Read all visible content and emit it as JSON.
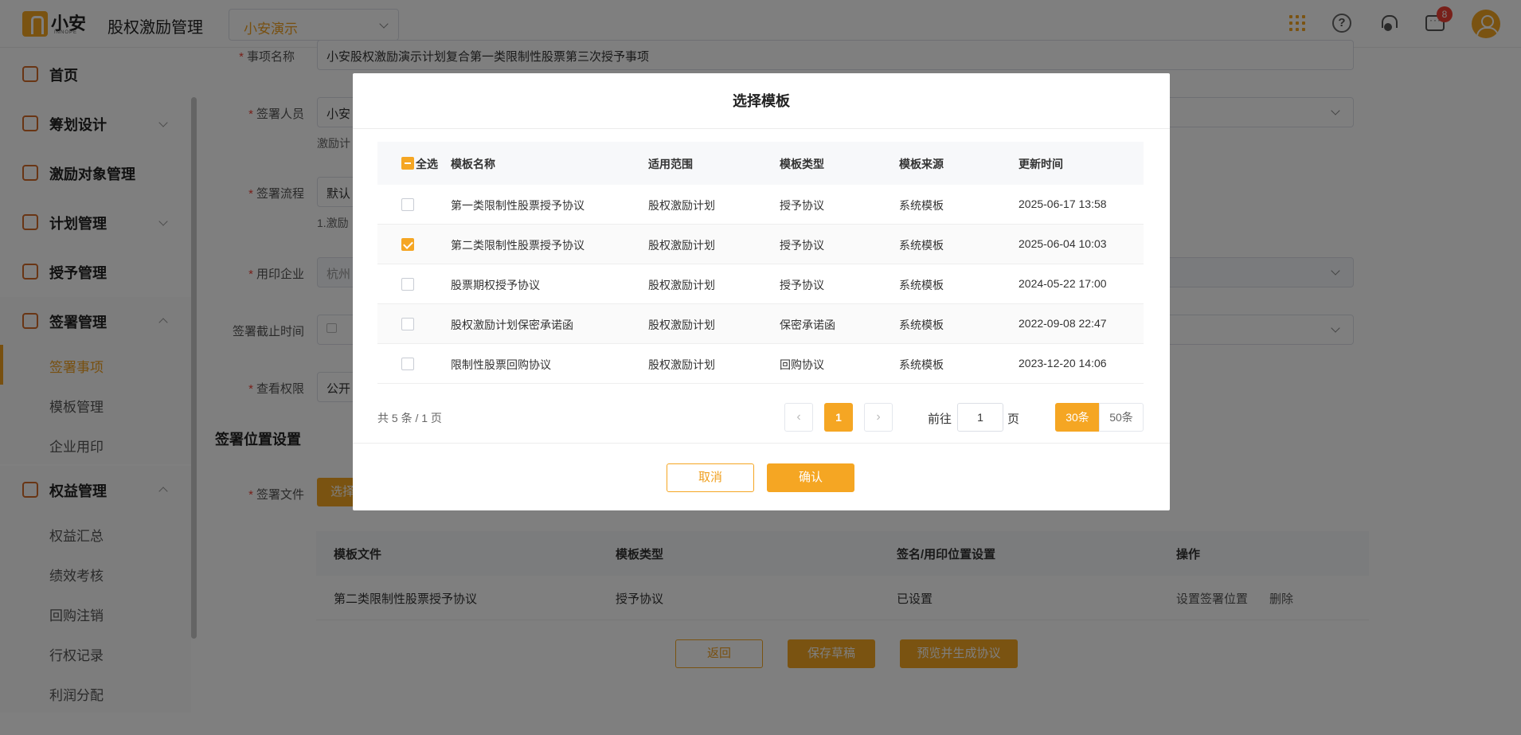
{
  "header": {
    "logo_cn": "小安",
    "logo_en": "INNOPE",
    "app_title": "股权激励管理",
    "project": "小安演示",
    "help": "?",
    "badge_count": "8"
  },
  "sidebar": {
    "items": [
      {
        "label": "首页",
        "icon": "home-icon"
      },
      {
        "label": "筹划设计",
        "icon": "edit-icon"
      },
      {
        "label": "激励对象管理",
        "icon": "users-icon"
      },
      {
        "label": "计划管理",
        "icon": "apps-icon"
      },
      {
        "label": "授予管理",
        "icon": "document-icon"
      },
      {
        "label": "签署管理",
        "icon": "sign-icon"
      },
      {
        "label": "权益管理",
        "icon": "equity-icon"
      }
    ],
    "sign_subs": [
      "签署事项",
      "模板管理",
      "企业用印"
    ],
    "equity_subs": [
      "权益汇总",
      "绩效考核",
      "回购注销",
      "行权记录",
      "利润分配"
    ]
  },
  "form": {
    "name_label": "事项名称",
    "name_value": "小安股权激励演示计划复合第一类限制性股票第三次授予事项",
    "signer_label": "签署人员",
    "signer_value": "小安",
    "signer_note": "激励计",
    "flow_label": "签署流程",
    "flow_value": "默认",
    "flow_note": "1.激励",
    "company_label": "用印企业",
    "company_value": "杭州",
    "deadline_label": "签署截止时间",
    "deadline_value": "",
    "perm_label": "查看权限",
    "perm_value": "公开",
    "section_title": "签署位置设置",
    "file_label": "签署文件",
    "select_btn": "选择"
  },
  "bottom_table": {
    "headers": [
      "模板文件",
      "模板类型",
      "签名/用印位置设置",
      "操作"
    ],
    "row": {
      "file": "第二类限制性股票授予协议",
      "type": "授予协议",
      "status": "已设置",
      "action1": "设置签署位置",
      "action2": "删除"
    }
  },
  "actions": {
    "back": "返回",
    "save": "保存草稿",
    "preview": "预览并生成协议"
  },
  "modal": {
    "title": "选择模板",
    "select_all": "全选",
    "headers": [
      "模板名称",
      "适用范围",
      "模板类型",
      "模板来源",
      "更新时间"
    ],
    "rows": [
      {
        "name": "第一类限制性股票授予协议",
        "scope": "股权激励计划",
        "type": "授予协议",
        "source": "系统模板",
        "time": "2025-06-17 13:58",
        "checked": false
      },
      {
        "name": "第二类限制性股票授予协议",
        "scope": "股权激励计划",
        "type": "授予协议",
        "source": "系统模板",
        "time": "2025-06-04 10:03",
        "checked": true
      },
      {
        "name": "股票期权授予协议",
        "scope": "股权激励计划",
        "type": "授予协议",
        "source": "系统模板",
        "time": "2024-05-22 17:00",
        "checked": false
      },
      {
        "name": "股权激励计划保密承诺函",
        "scope": "股权激励计划",
        "type": "保密承诺函",
        "source": "系统模板",
        "time": "2022-09-08 22:47",
        "checked": false
      },
      {
        "name": "限制性股票回购协议",
        "scope": "股权激励计划",
        "type": "回购协议",
        "source": "系统模板",
        "time": "2023-12-20 14:06",
        "checked": false
      }
    ],
    "pagination": {
      "total": "共 5 条 / 1 页",
      "current": "1",
      "goto_prefix": "前往",
      "goto_value": "1",
      "goto_suffix": "页",
      "sizes": [
        "30条",
        "50条"
      ],
      "prev": "‹",
      "next": "›"
    },
    "cancel": "取消",
    "confirm": "确认"
  }
}
